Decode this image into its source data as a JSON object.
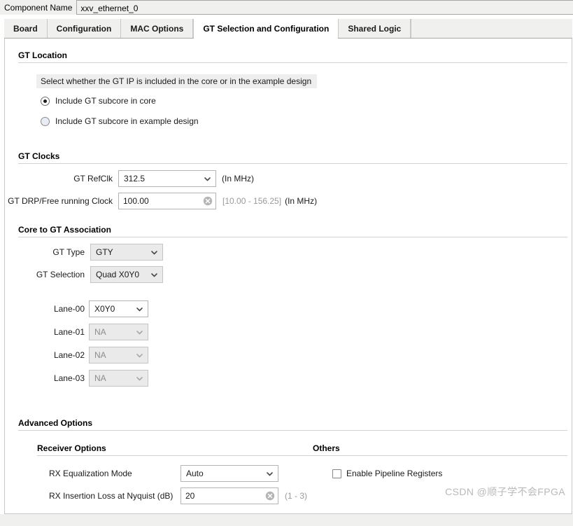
{
  "window": {
    "component_name_label": "Component Name",
    "component_name_value": "xxv_ethernet_0"
  },
  "tabs": [
    {
      "label": "Board",
      "active": false
    },
    {
      "label": "Configuration",
      "active": false
    },
    {
      "label": "MAC Options",
      "active": false
    },
    {
      "label": "GT Selection and Configuration",
      "active": true
    },
    {
      "label": "Shared Logic",
      "active": false
    }
  ],
  "gt_location": {
    "title": "GT Location",
    "hint": "Select whether the GT IP is included in the core or in the example design",
    "options": [
      {
        "label": "Include GT subcore in core",
        "selected": true
      },
      {
        "label": "Include GT subcore in example design",
        "selected": false
      }
    ]
  },
  "gt_clocks": {
    "title": "GT Clocks",
    "refclk": {
      "label": "GT RefClk",
      "value": "312.5",
      "suffix": "(In MHz)"
    },
    "drp": {
      "label": "GT DRP/Free running Clock",
      "value": "100.00",
      "range": "[10.00 - 156.25]",
      "suffix": "(In MHz)",
      "clear_icon": "clear-circle-icon"
    }
  },
  "core_to_gt": {
    "title": "Core to GT Association",
    "gt_type": {
      "label": "GT Type",
      "value": "GTY",
      "disabled": true
    },
    "gt_selection": {
      "label": "GT Selection",
      "value": "Quad X0Y0",
      "disabled": true
    },
    "lanes": [
      {
        "label": "Lane-00",
        "value": "X0Y0",
        "disabled": false
      },
      {
        "label": "Lane-01",
        "value": "NA",
        "disabled": true
      },
      {
        "label": "Lane-02",
        "value": "NA",
        "disabled": true
      },
      {
        "label": "Lane-03",
        "value": "NA",
        "disabled": true
      }
    ]
  },
  "advanced_options": {
    "title": "Advanced Options",
    "receiver_options": {
      "title": "Receiver Options",
      "rx_eq_mode": {
        "label": "RX Equalization Mode",
        "value": "Auto"
      },
      "rx_insertion_loss": {
        "label": "RX Insertion Loss at Nyquist (dB)",
        "value": "20",
        "range": "(1 - 3)"
      }
    },
    "others": {
      "title": "Others",
      "enable_pipeline_registers": {
        "label": "Enable Pipeline Registers",
        "checked": false
      }
    }
  },
  "watermark": "CSDN @顺子学不会FPGA"
}
